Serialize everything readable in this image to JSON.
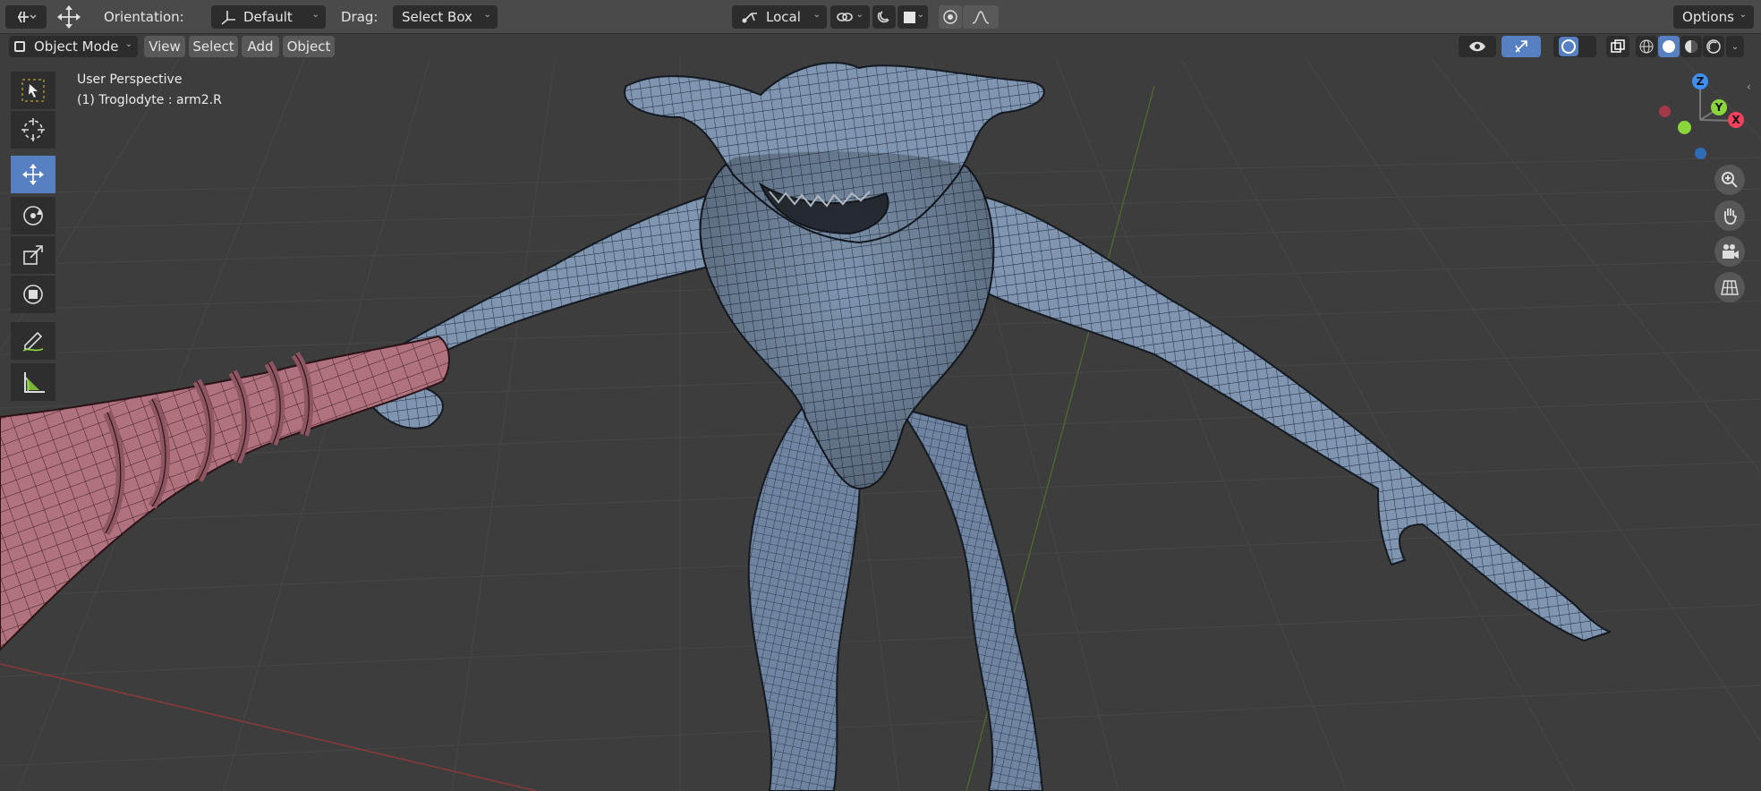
{
  "header": {
    "orientation_label": "Orientation:",
    "orientation_value": "Default",
    "drag_label": "Drag:",
    "drag_value": "Select Box",
    "pivot_value": "Local",
    "options_label": "Options"
  },
  "header2": {
    "mode_value": "Object Mode",
    "menu": [
      "View",
      "Select",
      "Add",
      "Object"
    ]
  },
  "viewport": {
    "perspective_label": "User Perspective",
    "object_label": "(1) Troglodyte : arm2.R"
  },
  "gizmo": {
    "z": "Z",
    "y": "Y",
    "x": "X"
  },
  "toolbar": {
    "tools": [
      "select-box",
      "cursor",
      "move",
      "rotate",
      "scale",
      "transform",
      "annotate",
      "measure"
    ],
    "active_tool": "move"
  },
  "colors": {
    "accent": "#5680c2",
    "mesh": "#7f95b0",
    "wire": "#1c2532",
    "club": "#b0727e",
    "axis_x": "#f0425c",
    "axis_y": "#8bd63a",
    "axis_z": "#3f8ff0"
  }
}
